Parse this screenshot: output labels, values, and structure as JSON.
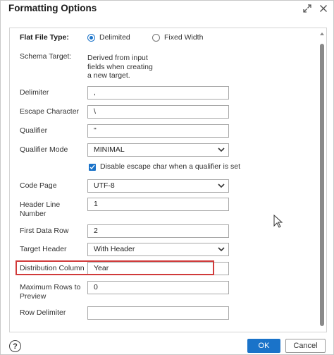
{
  "dialog": {
    "title": "Formatting Options",
    "expand_icon": "expand-arrows-icon",
    "close_icon": "close-icon"
  },
  "form": {
    "flat_file_type": {
      "label": "Flat File Type:",
      "options": [
        "Delimited",
        "Fixed Width"
      ],
      "selected": "Delimited"
    },
    "schema_target": {
      "label": "Schema Target:",
      "lines": [
        "Derived from input",
        "fields when creating",
        "a new target."
      ]
    },
    "delimiter": {
      "label": "Delimiter",
      "value": ","
    },
    "escape_character": {
      "label": "Escape Character",
      "value": "\\"
    },
    "qualifier": {
      "label": "Qualifier",
      "value": "\""
    },
    "qualifier_mode": {
      "label": "Qualifier Mode",
      "value": "MINIMAL"
    },
    "disable_escape": {
      "label": "Disable escape char when a qualifier is set",
      "checked": true
    },
    "code_page": {
      "label": "Code Page",
      "value": "UTF-8"
    },
    "header_line_number": {
      "label_lines": [
        "Header Line",
        "Number"
      ],
      "value": "1"
    },
    "first_data_row": {
      "label": "First Data Row",
      "value": "2"
    },
    "target_header": {
      "label": "Target Header",
      "value": "With Header"
    },
    "distribution_column": {
      "label": "Distribution Column",
      "value": "Year"
    },
    "maximum_rows_to_preview": {
      "label_lines": [
        "Maximum Rows to",
        "Preview"
      ],
      "value": "0"
    },
    "row_delimiter": {
      "label": "Row Delimiter",
      "value": ""
    }
  },
  "footer": {
    "help_label": "?",
    "ok_label": "OK",
    "cancel_label": "Cancel"
  },
  "colors": {
    "accent": "#1a73c9",
    "highlight_border": "#d03a3a"
  }
}
